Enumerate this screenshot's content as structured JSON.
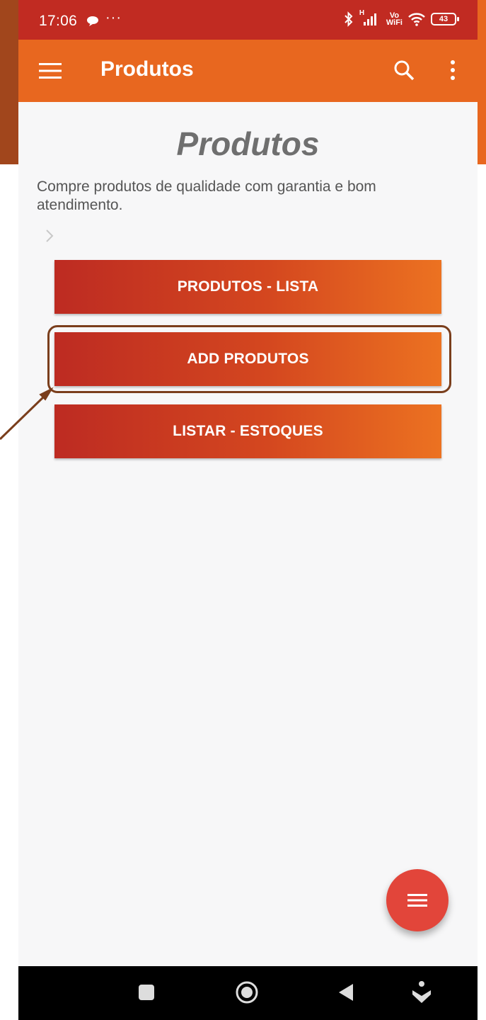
{
  "status_bar": {
    "time": "17:06",
    "more_dots": "···",
    "signal_tag": "H",
    "vowifi_top": "Vo",
    "vowifi_bottom": "WiFi",
    "battery": "43"
  },
  "toolbar": {
    "title": "Produtos",
    "icons": [
      "menu-icon",
      "search-icon",
      "more-vert-icon"
    ]
  },
  "content": {
    "heading": "Produtos",
    "description": "Compre produtos de qualidade com garantia e bom atendimento.",
    "buttons": [
      {
        "label": "PRODUTOS - LISTA"
      },
      {
        "label": "ADD PRODUTOS"
      },
      {
        "label": "LISTAR - ESTOQUES"
      }
    ]
  },
  "fab": {
    "icon": "menu-icon"
  },
  "nav_bar": {
    "icons": [
      "recents-icon",
      "home-icon",
      "back-icon",
      "assistant-icon"
    ]
  },
  "colors": {
    "status_bar": "#c12b22",
    "toolbar": "#e8671f",
    "button_gradient_start": "#bd2b22",
    "button_gradient_end": "#ec7221",
    "fab": "#e2453a",
    "annotation": "#7a3e1c"
  }
}
